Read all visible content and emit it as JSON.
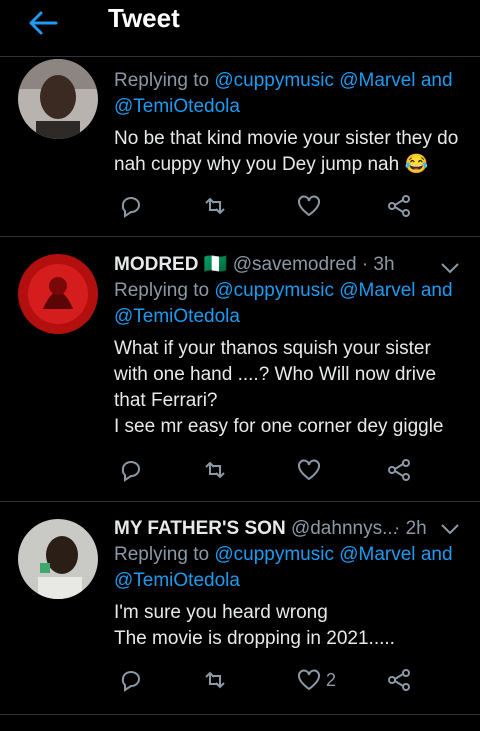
{
  "header": {
    "title": "Tweet"
  },
  "tweets": [
    {
      "replying_label": "Replying to",
      "mentions": [
        "@cuppymusic",
        "@Marvel",
        "@TemiOtedola"
      ],
      "and_word": "and",
      "body": [
        "No be that kind movie your sister they do",
        "nah cuppy why you Dey jump nah 😂"
      ]
    },
    {
      "name": "MODRED",
      "flag": "🇳🇬",
      "handle": "@savemodred",
      "time": "· 3h",
      "replying_label": "Replying to",
      "mentions": [
        "@cuppymusic",
        "@Marvel",
        "@TemiOtedola"
      ],
      "and_word": "and",
      "body": [
        "What if your thanos squish your sister",
        "with one hand ....? Who Will now drive",
        "that Ferrari?",
        "I see mr easy for one corner dey giggle"
      ]
    },
    {
      "name": "MY FATHER'S SON",
      "handle": "@dahnnys...",
      "time": "· 2h",
      "replying_label": "Replying to",
      "mentions": [
        "@cuppymusic",
        "@Marvel",
        "@TemiOtedola"
      ],
      "and_word": "and",
      "body": [
        "I'm sure you heard wrong",
        "The movie is dropping in 2021....."
      ],
      "like_count": "2"
    }
  ],
  "icons": {
    "back": "arrow-left-icon",
    "reply": "reply-icon",
    "retweet": "retweet-icon",
    "like": "heart-icon",
    "share": "share-icon",
    "more": "chevron-down-icon"
  },
  "colors": {
    "accent": "#1d9bf0",
    "muted": "#8b98a5",
    "background": "#000000"
  }
}
